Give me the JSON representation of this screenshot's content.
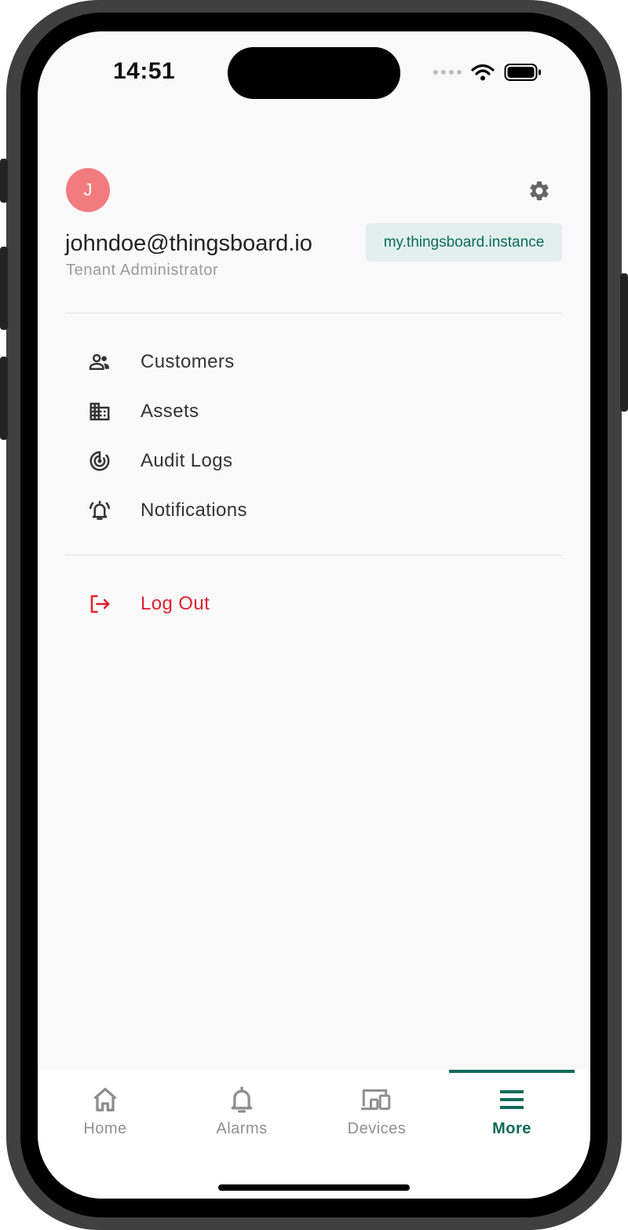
{
  "status_bar": {
    "time": "14:51"
  },
  "profile": {
    "avatar_initial": "J",
    "email": "johndoe@thingsboard.io",
    "role": "Tenant Administrator",
    "instance": "my.thingsboard.instance"
  },
  "menu": {
    "items": [
      {
        "label": "Customers",
        "icon": "customers-icon"
      },
      {
        "label": "Assets",
        "icon": "building-icon"
      },
      {
        "label": "Audit Logs",
        "icon": "track-changes-icon"
      },
      {
        "label": "Notifications",
        "icon": "bell-ring-icon"
      }
    ],
    "logout_label": "Log Out"
  },
  "tabbar": {
    "tabs": [
      {
        "label": "Home",
        "icon": "home-icon",
        "active": false
      },
      {
        "label": "Alarms",
        "icon": "bell-icon",
        "active": false
      },
      {
        "label": "Devices",
        "icon": "devices-icon",
        "active": false
      },
      {
        "label": "More",
        "icon": "menu-icon",
        "active": true
      }
    ]
  },
  "colors": {
    "accent": "#0e6b5c",
    "avatar": "#f27b7f",
    "logout": "#e02030",
    "instance_bg": "#e3efee"
  }
}
